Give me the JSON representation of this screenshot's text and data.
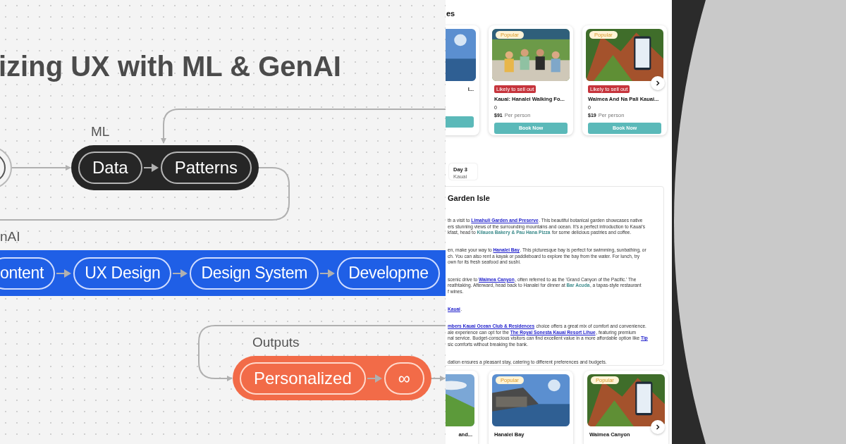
{
  "canvas": {
    "title": "izing UX with ML & GenAI",
    "groups": [
      {
        "label": "ML",
        "kind": "dark",
        "nodes": [
          "Data",
          "Patterns"
        ]
      },
      {
        "label": "nAI",
        "kind": "blue",
        "nodes": [
          "ontent",
          "UX Design",
          "Design System",
          "Developme"
        ]
      },
      {
        "label": "Outputs",
        "kind": "orange",
        "nodes": [
          "Personalized",
          "∞"
        ]
      }
    ]
  },
  "page": {
    "heading": "es",
    "top_cards": [
      {
        "kind": "partial",
        "title": "l..."
      },
      {
        "kind": "full",
        "badge": "Popular",
        "alert": "Likely to sell out",
        "title": "Kauai: Hanalei Walking Fo...",
        "rating": "0",
        "price": "$91",
        "price_unit": "Per person",
        "button": "Book Now"
      },
      {
        "kind": "full",
        "badge": "Popular",
        "alert": "Likely to sell out",
        "title": "Waimea And Na Pali Kauai...",
        "rating": "0",
        "price": "$19",
        "price_unit": "Per person",
        "button": "Book Now"
      }
    ],
    "day_tab": {
      "title": "Day 3",
      "subtitle": "Kauai"
    },
    "section": {
      "heading": "Garden Isle",
      "paragraphs": [
        [
          [
            {
              "kind": "text",
              "text": "th a visit to "
            },
            {
              "kind": "link",
              "text": "Limahuli Garden and Preserve"
            },
            {
              "kind": "text",
              "text": ". This beautiful botanical garden showcases native"
            }
          ],
          [
            {
              "kind": "text",
              "text": "ers stunning views of the surrounding mountains and ocean. It's a perfect introduction to Kauai's"
            }
          ],
          [
            {
              "kind": "text",
              "text": "kfast, head to "
            },
            {
              "kind": "place",
              "text": "Kilauea Bakery & Pau Hana Pizza"
            },
            {
              "kind": "text",
              "text": " for some delicious pastries and coffee."
            }
          ]
        ],
        [
          [
            {
              "kind": "text",
              "text": "en, make your way to "
            },
            {
              "kind": "link",
              "text": "Hanalei Bay"
            },
            {
              "kind": "text",
              "text": ". This picturesque bay is perfect for swimming, sunbathing, or"
            }
          ],
          [
            {
              "kind": "text",
              "text": "ch. You can also rent a kayak or paddleboard to explore the bay from the water. For lunch, try"
            }
          ],
          [
            {
              "kind": "text",
              "text": "own for its fresh seafood and sushi."
            }
          ]
        ],
        [
          [
            {
              "kind": "text",
              "text": "scenic drive to "
            },
            {
              "kind": "link",
              "text": "Waimea Canyon"
            },
            {
              "kind": "text",
              "text": ", often referred to as the 'Grand Canyon of the Pacific.' The"
            }
          ],
          [
            {
              "kind": "text",
              "text": "reathtaking. Afterward, head back to Hanalei for dinner at "
            },
            {
              "kind": "place",
              "text": "Bar Acuda"
            },
            {
              "kind": "text",
              "text": ", a tapas-style restaurant"
            }
          ],
          [
            {
              "kind": "text",
              "text": "f wines."
            }
          ]
        ],
        [
          [
            {
              "kind": "link",
              "text": "Kauai"
            },
            {
              "kind": "text",
              "text": "."
            }
          ]
        ],
        [
          [
            {
              "kind": "link",
              "text": "mbers Kauai Ocean Club & Residences"
            },
            {
              "kind": "text",
              "text": " choice offers a great mix of comfort and convenience."
            }
          ],
          [
            {
              "kind": "text",
              "text": "ale experience can opt for the "
            },
            {
              "kind": "link",
              "text": "The Royal Sonesta Kauai Resort Lihue"
            },
            {
              "kind": "text",
              "text": ", featuring premium"
            }
          ],
          [
            {
              "kind": "text",
              "text": "nal service. Budget-conscious visitors can find excellent value in a more affordable option like "
            },
            {
              "kind": "link",
              "text": "Tip"
            }
          ],
          [
            {
              "kind": "text",
              "text": "sic comforts without breaking the bank."
            }
          ]
        ],
        [
          [
            {
              "kind": "text",
              "text": "dation ensures a pleasant stay, catering to different preferences and budgets."
            }
          ]
        ]
      ]
    },
    "bottom_cards": [
      {
        "kind": "partial",
        "title": "and..."
      },
      {
        "kind": "full",
        "badge": "Popular",
        "title": "Hanalei Bay"
      },
      {
        "kind": "full",
        "badge": "Popular",
        "title": "Waimea Canyon"
      }
    ]
  }
}
